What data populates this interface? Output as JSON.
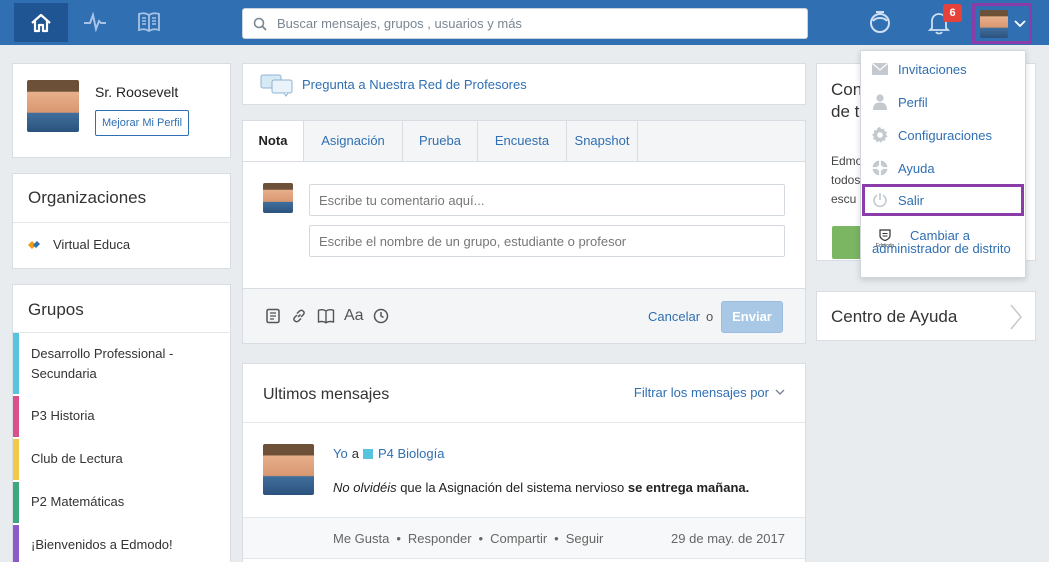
{
  "topbar": {
    "search_placeholder": "Buscar mensajes, grupos , usuarios y más",
    "notification_count": "6",
    "accent": "#2f6fb2"
  },
  "profile": {
    "name": "Sr. Roosevelt",
    "improve_button": "Mejorar Mi Perfil"
  },
  "organizations": {
    "title": "Organizaciones",
    "items": [
      {
        "label": "Virtual Educa"
      }
    ]
  },
  "groups": {
    "title": "Grupos",
    "items": [
      {
        "label": "Desarrollo Professional - Secundaria",
        "color": "#58c4dd"
      },
      {
        "label": "P3 Historia",
        "color": "#d9508a"
      },
      {
        "label": "Club de Lectura",
        "color": "#f2c94c"
      },
      {
        "label": "P2 Matemáticas",
        "color": "#3ea77b"
      },
      {
        "label": "¡Bienvenidos a Edmodo!",
        "color": "#8a5cc9"
      }
    ]
  },
  "ask_network": {
    "label": "Pregunta a Nuestra Red de Profesores"
  },
  "composer": {
    "tabs": [
      {
        "label": "Nota",
        "active": true
      },
      {
        "label": "Asignación"
      },
      {
        "label": "Prueba"
      },
      {
        "label": "Encuesta"
      },
      {
        "label": "Snapshot"
      }
    ],
    "comment_placeholder": "Escribe tu comentario aquí...",
    "recipient_placeholder": "Escribe el nombre de un grupo, estudiante o profesor",
    "font_label": "Aa",
    "cancel_label": "Cancelar",
    "or_label": "o",
    "send_label": "Enviar"
  },
  "feed": {
    "title": "Ultimos mensajes",
    "filter_label": "Filtrar los mensajes por",
    "post": {
      "author": "Yo",
      "to_word": "a",
      "group": "P4 Biología",
      "group_color": "#58c4dd",
      "body_italic": "No olvidéis",
      "body_text": " que la Asignación del sistema nervioso ",
      "body_bold": "se entrega mañana.",
      "actions": [
        "Me Gusta",
        "Responder",
        "Compartir",
        "Seguir"
      ],
      "date": "29 de may. de 2017"
    }
  },
  "right_panel": {
    "card_title_partial": "Con de t",
    "card_text_partial": "Edmo todos escu",
    "help_center": "Centro de Ayuda"
  },
  "user_menu": {
    "items": [
      {
        "label": "Invitaciones",
        "icon": "envelope-icon"
      },
      {
        "label": "Perfil",
        "icon": "person-icon"
      },
      {
        "label": "Configuraciones",
        "icon": "gear-icon"
      },
      {
        "label": "Ayuda",
        "icon": "lifebuoy-icon"
      },
      {
        "label": "Salir",
        "icon": "power-icon",
        "highlighted": true
      }
    ],
    "district_admin": "Cambiar a administrador de distrito",
    "edmodo_logo_text": "Edmodo"
  }
}
